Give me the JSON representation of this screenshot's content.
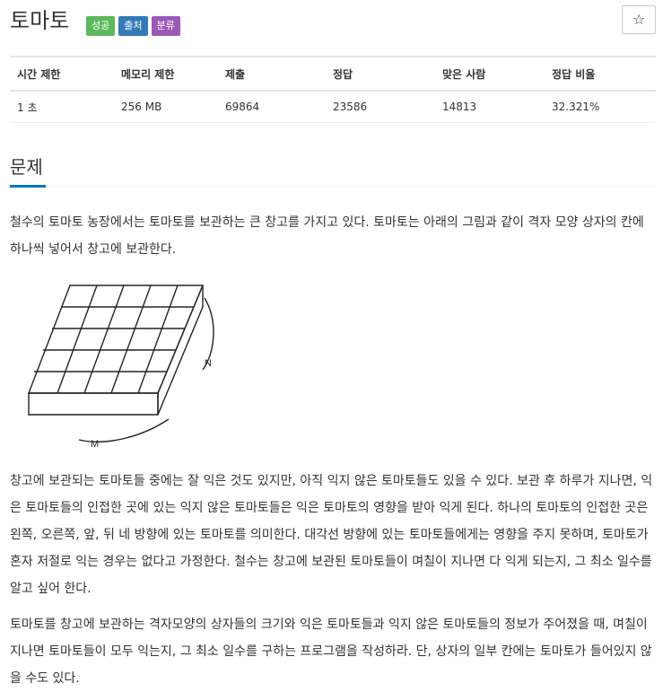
{
  "problem": {
    "title": "토마토",
    "badges": [
      {
        "label": "성공",
        "color": "#5cb85c"
      },
      {
        "label": "출처",
        "color": "#337ab7"
      },
      {
        "label": "분류",
        "color": "#9b59b6"
      }
    ],
    "star": "☆"
  },
  "stats": {
    "headers": [
      "시간 제한",
      "메모리 제한",
      "제출",
      "정답",
      "맞은 사람",
      "정답 비율"
    ],
    "values": [
      "1 초",
      "256 MB",
      "69864",
      "23586",
      "14813",
      "32.321%"
    ]
  },
  "section": {
    "title": "문제"
  },
  "figure": {
    "label_m": "M",
    "label_n": "N"
  },
  "paragraphs": [
    "철수의 토마토 농장에서는 토마토를 보관하는 큰 창고를 가지고 있다. 토마토는 아래의 그림과 같이 격자 모양 상자의 칸에 하나씩 넣어서 창고에 보관한다.",
    "창고에 보관되는 토마토들 중에는 잘 익은 것도 있지만, 아직 익지 않은 토마토들도 있을 수 있다. 보관 후 하루가 지나면, 익은 토마토들의 인접한 곳에 있는 익지 않은 토마토들은 익은 토마토의 영향을 받아 익게 된다. 하나의 토마토의 인접한 곳은 왼쪽, 오른쪽, 앞, 뒤 네 방향에 있는 토마토를 의미한다. 대각선 방향에 있는 토마토들에게는 영향을 주지 못하며, 토마토가 혼자 저절로 익는 경우는 없다고 가정한다. 철수는 창고에 보관된 토마토들이 며칠이 지나면 다 익게 되는지, 그 최소 일수를 알고 싶어 한다.",
    "토마토를 창고에 보관하는 격자모양의 상자들의 크기와 익은 토마토들과 익지 않은 토마토들의 정보가 주어졌을 때, 며칠이 지나면 토마토들이 모두 익는지, 그 최소 일수를 구하는 프로그램을 작성하라. 단, 상자의 일부 칸에는 토마토가 들어있지 않을 수도 있다."
  ]
}
